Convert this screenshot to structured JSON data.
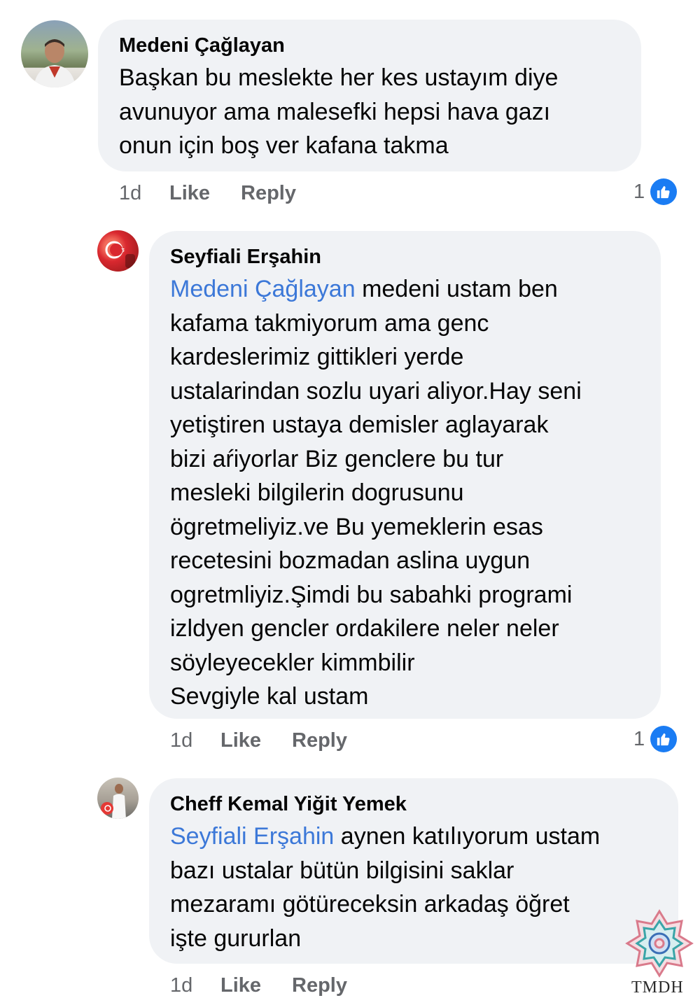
{
  "comments": [
    {
      "author": "Medeni Çağlayan",
      "avatar": "avatar-man-outdoor",
      "mention": "",
      "lines": [
        "Başkan bu meslekte her kes ustayım diye",
        "avunuyor ama malesefki hepsi hava gazı",
        "onun için boş ver kafana takma"
      ],
      "time": "1d",
      "like_label": "Like",
      "reply_label": "Reply",
      "like_count": "1"
    },
    {
      "author": "Seyfiali Erşahin",
      "avatar": "avatar-red-flag",
      "mention": "Medeni Çağlayan",
      "first_line_rest": " medeni  ustam ben",
      "lines": [
        "kafama takmiyorum  ama genc",
        "kardeslerimiz gittikleri  yerde",
        "ustalarindan sozlu uyari aliyor.Hay seni",
        "yetiştiren ustaya  demisler  aglayarak",
        "bizi aŕiyorlar Biz  genclere  bu tur",
        "mesleki bilgilerin dogrusunu",
        "ögretmeliyiz.ve Bu yemeklerin esas",
        "recetesini bozmadan aslina uygun",
        "ogretmliyiz.Şimdi bu sabahki programi",
        "izldyen gencler ordakilere neler neler",
        "söyleyecekler kimmbilir",
        "Sevgiyle kal ustam"
      ],
      "time": "1d",
      "like_label": "Like",
      "reply_label": "Reply",
      "like_count": "1"
    },
    {
      "author": "Cheff Kemal Yiğit Yemek",
      "avatar": "avatar-chef",
      "mention": "Seyfiali Erşahin",
      "first_line_rest": " aynen katılıyorum ustam",
      "lines": [
        "bazı ustalar bütün bilgisini saklar",
        "mezaramı götüreceksin arkadaş öğret",
        "işte gururlan"
      ],
      "time": "1d",
      "like_label": "Like",
      "reply_label": "Reply"
    }
  ],
  "colors": {
    "bubble": "#f0f2f5",
    "mention": "#3c78d8",
    "like_badge": "#1a7cf3",
    "meta_text": "#65676b"
  },
  "watermark": {
    "text": "TMDH",
    "icon": "ornament-rosette-icon"
  }
}
